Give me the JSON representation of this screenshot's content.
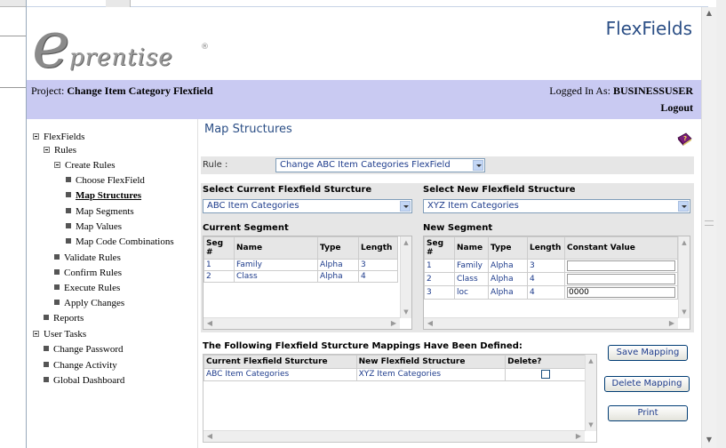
{
  "app": {
    "title": "FlexFields",
    "logo_text": "prentise",
    "logo_mark": "e",
    "logo_reg": "®"
  },
  "header": {
    "project_label": "Project: ",
    "project_name": "Change Item Category Flexfield",
    "logged_in_label": "Logged In As: ",
    "logged_in_user": "BUSINESSUSER",
    "logout": "Logout"
  },
  "nav": {
    "flexfields": "FlexFields",
    "rules": "Rules",
    "create_rules": "Create Rules",
    "choose_flexfield": "Choose FlexField",
    "map_structures": "Map Structures",
    "map_segments": "Map Segments",
    "map_values": "Map Values",
    "map_code_combinations": "Map Code Combinations",
    "validate_rules": "Validate Rules",
    "confirm_rules": "Confirm Rules",
    "execute_rules": "Execute Rules",
    "apply_changes": "Apply Changes",
    "reports": "Reports",
    "user_tasks": "User Tasks",
    "change_password": "Change Password",
    "change_activity": "Change Activity",
    "global_dashboard": "Global Dashboard"
  },
  "main": {
    "page_title": "Map Structures",
    "rule_label": "Rule :",
    "rule_value": "Change ABC Item Categories FlexField",
    "select_current_heading": "Select Current Flexfield Sturcture",
    "select_new_heading": "Select New Flexfield Structure",
    "current_structure_value": "ABC Item Categories",
    "new_structure_value": "XYZ Item Categories",
    "current_segment_heading": "Current Segment",
    "new_segment_heading": "New Segment",
    "current_segment": {
      "headers": {
        "seg": "Seg #",
        "name": "Name",
        "type": "Type",
        "length": "Length"
      },
      "rows": [
        {
          "seg": "1",
          "name": "Family",
          "type": "Alpha",
          "length": "3"
        },
        {
          "seg": "2",
          "name": "Class",
          "type": "Alpha",
          "length": "4"
        }
      ]
    },
    "new_segment": {
      "headers": {
        "seg": "Seg #",
        "name": "Name",
        "type": "Type",
        "length": "Length",
        "constant": "Constant Value"
      },
      "rows": [
        {
          "seg": "1",
          "name": "Family",
          "type": "Alpha",
          "length": "3",
          "constant": ""
        },
        {
          "seg": "2",
          "name": "Class",
          "type": "Alpha",
          "length": "4",
          "constant": ""
        },
        {
          "seg": "3",
          "name": "loc",
          "type": "Alpha",
          "length": "4",
          "constant": "0000"
        }
      ]
    },
    "mappings_heading": "The Following Flexfield Sturcture Mappings Have Been Defined:",
    "mappings": {
      "headers": {
        "current": "Current Flexfield Sturcture",
        "new": "New Flexfield Structure",
        "delete": "Delete?"
      },
      "rows": [
        {
          "current": "ABC Item Categories",
          "new": "XYZ Item Categories",
          "delete": false
        }
      ]
    },
    "buttons": {
      "save": "Save Mapping",
      "delete": "Delete Mapping",
      "print": "Print"
    }
  },
  "icons": {
    "help": "help-book-icon",
    "expand": "tree-minus-icon",
    "leaf": "tree-bullet-icon"
  },
  "colors": {
    "title_blue": "#2c4f86",
    "project_bar": "#c9caf2",
    "panel_gray": "#e6e6e6",
    "data_text": "#1e3c8c"
  }
}
